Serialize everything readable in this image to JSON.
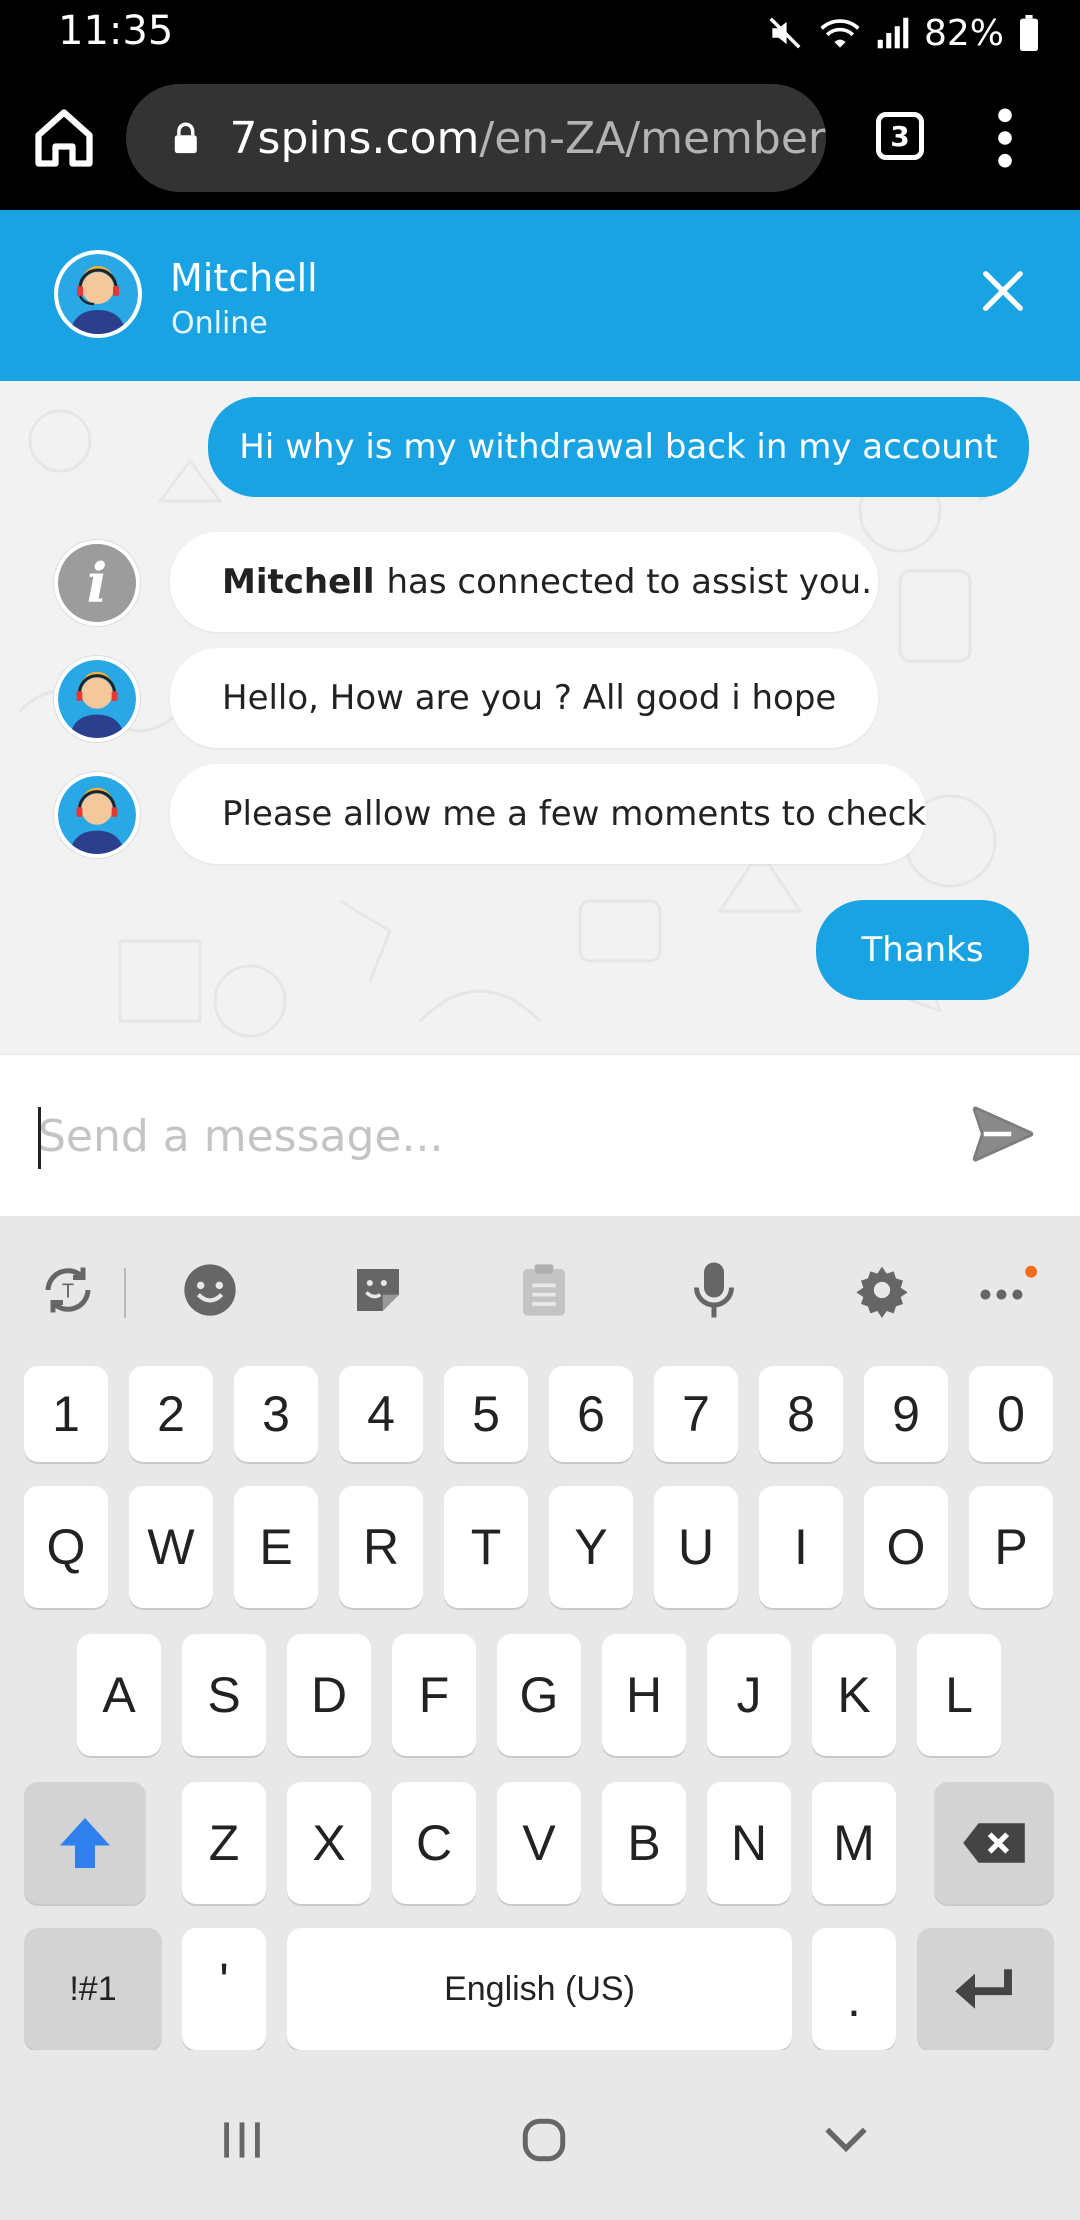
{
  "status_bar": {
    "time": "11:35",
    "battery": "82%",
    "icons": [
      "mute-icon",
      "wifi-icon",
      "signal-icon",
      "battery-icon"
    ]
  },
  "browser": {
    "url_domain": "7spins.com",
    "url_path": "/en-ZA/member",
    "tab_count": "3"
  },
  "chat_header": {
    "agent_name": "Mitchell",
    "agent_status": "Online"
  },
  "messages": [
    {
      "from": "user",
      "text": "Hi why is my withdrawal back in my account"
    },
    {
      "from": "system",
      "bold": "Mitchell",
      "text": "has connected to assist you."
    },
    {
      "from": "agent",
      "text": "Hello, How are you ? All good i hope"
    },
    {
      "from": "agent",
      "text": "Please allow me a few moments to check"
    },
    {
      "from": "user",
      "text": "Thanks"
    }
  ],
  "composer": {
    "placeholder": "Send a message..."
  },
  "keyboard": {
    "row_numbers": [
      "1",
      "2",
      "3",
      "4",
      "5",
      "6",
      "7",
      "8",
      "9",
      "0"
    ],
    "row_top": [
      "Q",
      "W",
      "E",
      "R",
      "T",
      "Y",
      "U",
      "I",
      "O",
      "P"
    ],
    "row_middle": [
      "A",
      "S",
      "D",
      "F",
      "G",
      "H",
      "J",
      "K",
      "L"
    ],
    "row_bottom": [
      "Z",
      "X",
      "C",
      "V",
      "B",
      "N",
      "M"
    ],
    "symbols_key": "!#1",
    "apostrophe_key": "'",
    "space_label": "English (US)",
    "period_key": "."
  },
  "colors": {
    "accent": "#1aa3e2",
    "shift": "#2f80ed",
    "notification_dot": "#f26b1d"
  }
}
